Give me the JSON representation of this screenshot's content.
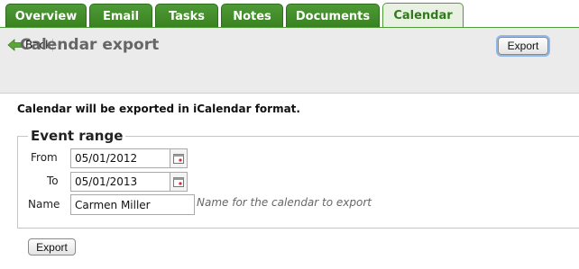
{
  "tabs": [
    {
      "label": "Overview",
      "active": false
    },
    {
      "label": "Email",
      "active": false
    },
    {
      "label": "Tasks",
      "active": false
    },
    {
      "label": "Notes",
      "active": false
    },
    {
      "label": "Documents",
      "active": false
    },
    {
      "label": "Calendar",
      "active": true
    }
  ],
  "header": {
    "back_label": "Back",
    "title": "Calendar export",
    "export_button": "Export"
  },
  "info_text": "Calendar will be exported in iCalendar format.",
  "event_range": {
    "legend": "Event range",
    "from_label": "From",
    "from_value": "05/01/2012",
    "to_label": "To",
    "to_value": "05/01/2013",
    "name_label": "Name",
    "name_value": "Carmen Miller",
    "name_hint": "Name for the calendar to export"
  },
  "footer": {
    "export_button": "Export"
  },
  "icons": {
    "back": "back-arrow-icon",
    "calendar": "calendar-icon"
  },
  "colors": {
    "tab_green": "#3f8a28",
    "active_tab_bg": "#e9f2e2",
    "header_bg": "#ebebeb",
    "focus_ring": "#8fb8ec"
  }
}
